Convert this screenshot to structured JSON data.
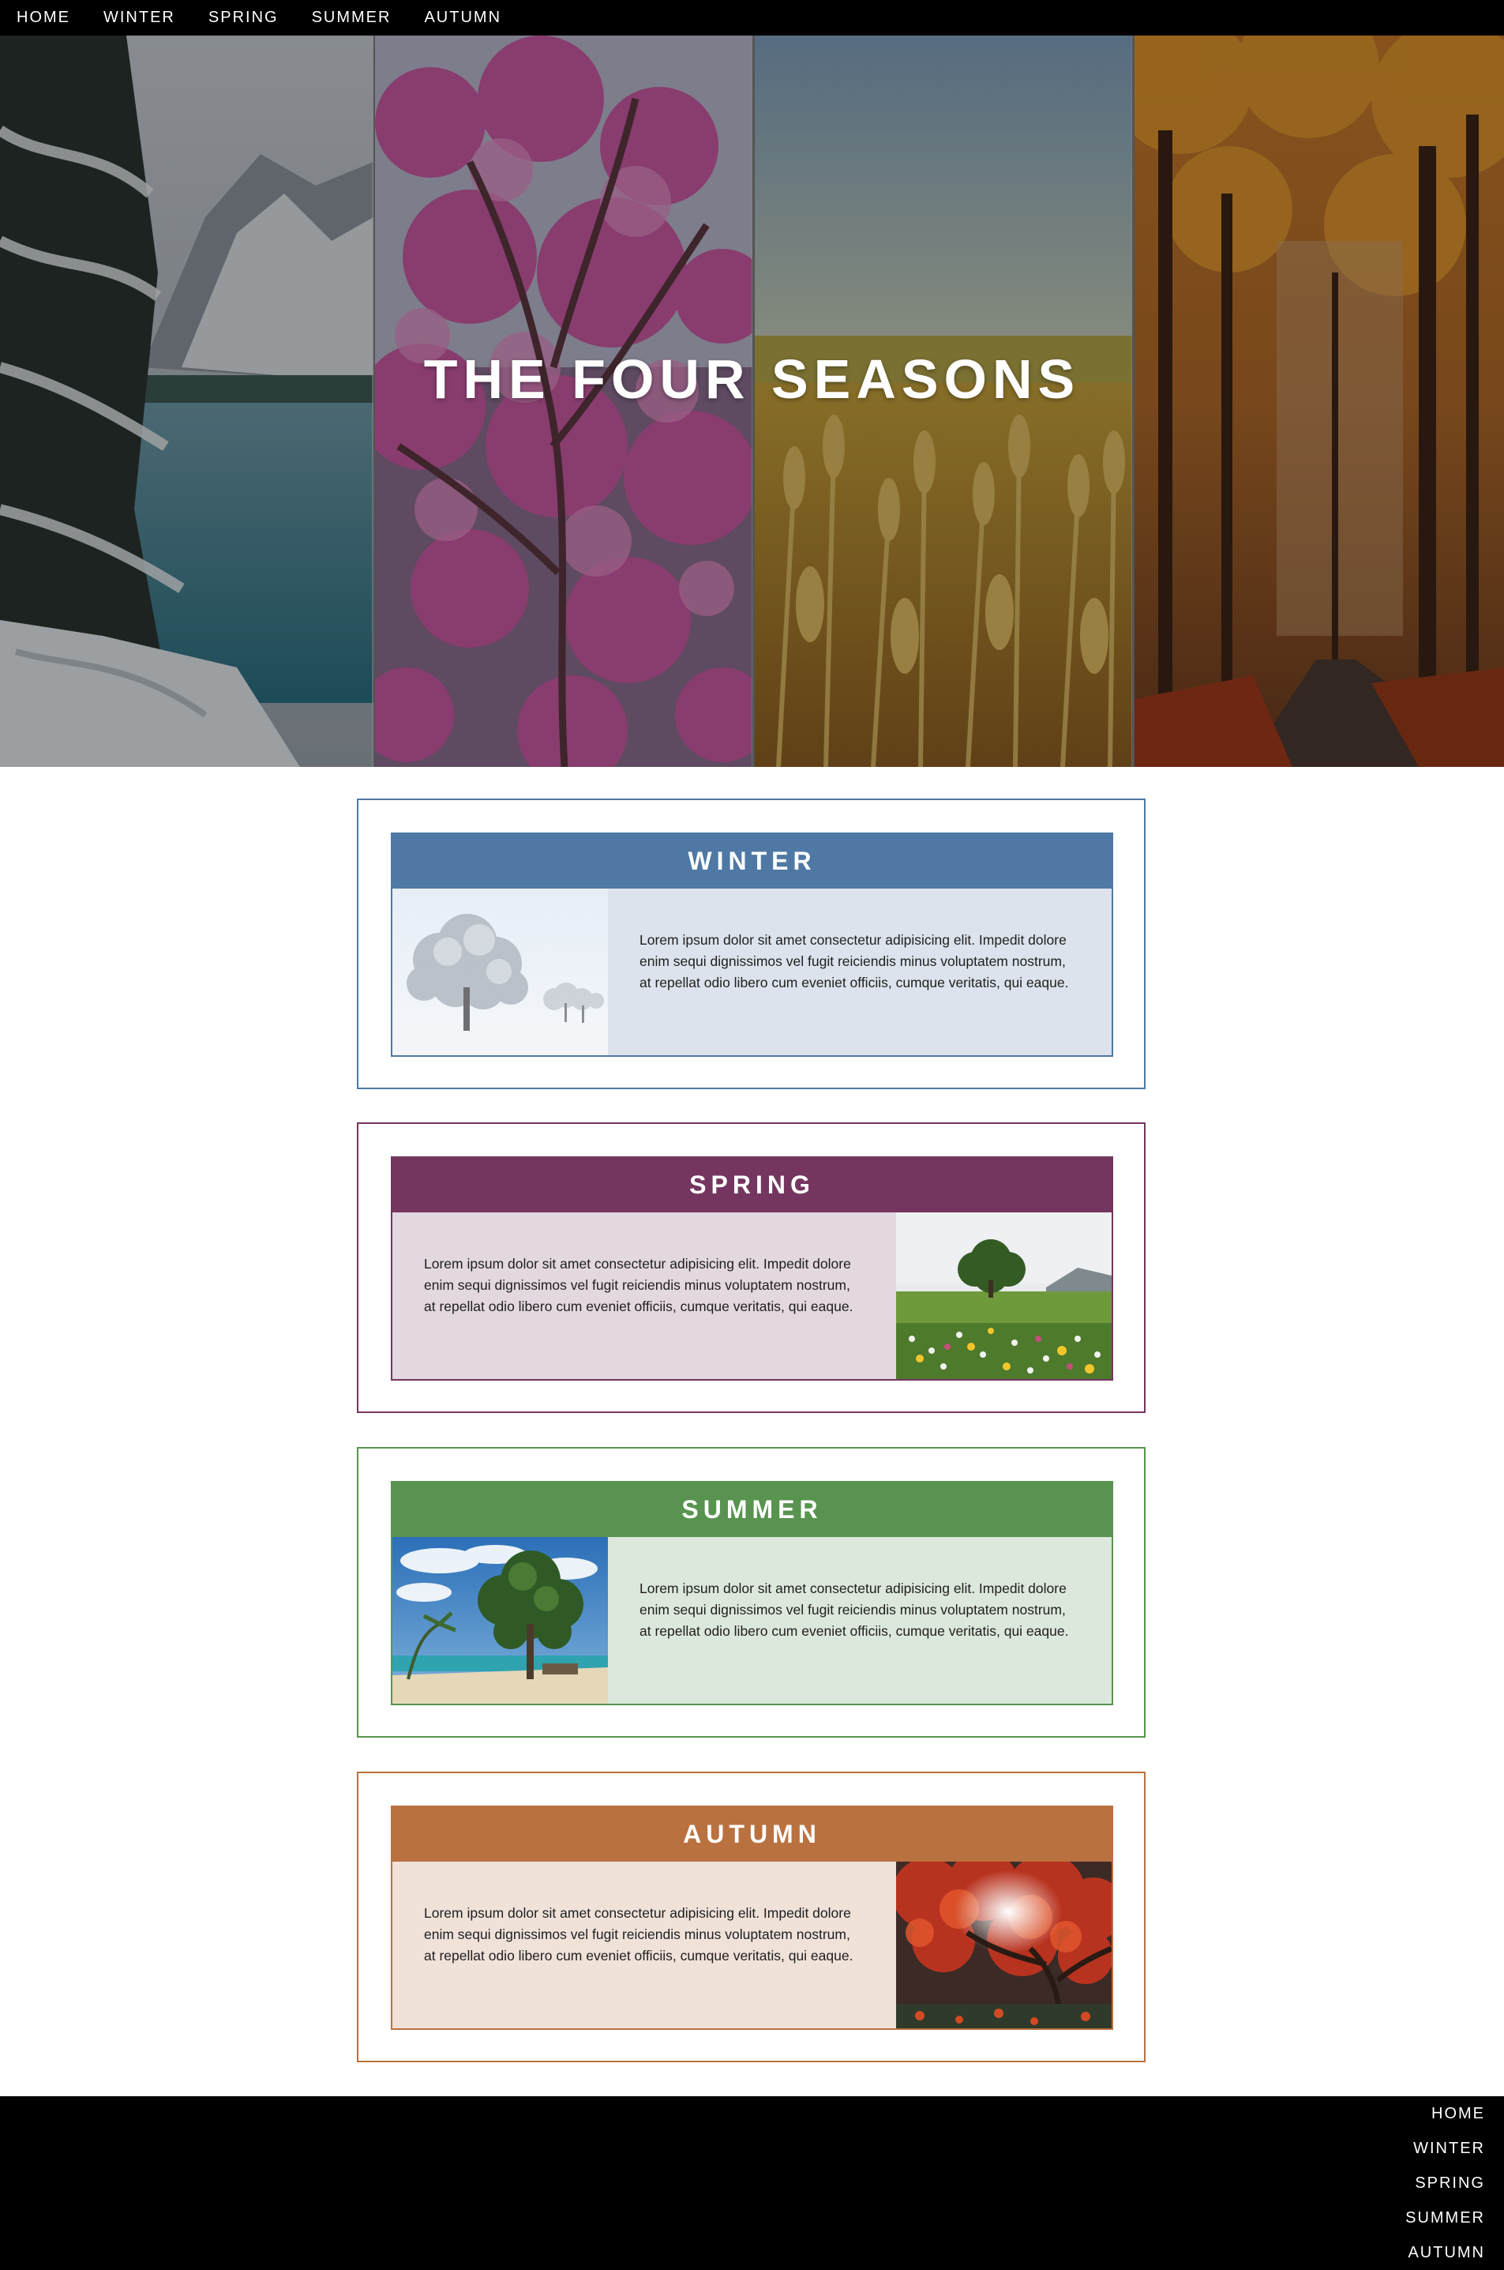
{
  "nav": {
    "items": [
      "HOME",
      "WINTER",
      "SPRING",
      "SUMMER",
      "AUTUMN"
    ]
  },
  "hero": {
    "title": "THE FOUR SEASONS",
    "panels": [
      "winter-lake-photo",
      "spring-blossom-photo",
      "summer-wheat-photo",
      "autumn-forest-photo"
    ]
  },
  "seasons": [
    {
      "title": "WINTER",
      "text": "Lorem ipsum dolor sit amet consectetur adipisicing elit. Impedit dolore enim sequi dignissimos vel fugit reiciendis minus voluptatem nostrum, at repellat odio libero cum eveniet officiis, cumque veritatis, qui eaque.",
      "image": "snowy-tree-photo",
      "accent": "#4f79a4",
      "tint": "#dde3ec"
    },
    {
      "title": "SPRING",
      "text": "Lorem ipsum dolor sit amet consectetur adipisicing elit. Impedit dolore enim sequi dignissimos vel fugit reiciendis minus voluptatem nostrum, at repellat odio libero cum eveniet officiis, cumque veritatis, qui eaque.",
      "image": "flower-meadow-photo",
      "accent": "#74365f",
      "tint": "#e3d7e0"
    },
    {
      "title": "SUMMER",
      "text": "Lorem ipsum dolor sit amet consectetur adipisicing elit. Impedit dolore enim sequi dignissimos vel fugit reiciendis minus voluptatem nostrum, at repellat odio libero cum eveniet officiis, cumque veritatis, qui eaque.",
      "image": "beach-tree-photo",
      "accent": "#58944f",
      "tint": "#dde8dc"
    },
    {
      "title": "AUTUMN",
      "text": "Lorem ipsum dolor sit amet consectetur adipisicing elit. Impedit dolore enim sequi dignissimos vel fugit reiciendis minus voluptatem nostrum, at repellat odio libero cum eveniet officiis, cumque veritatis, qui eaque.",
      "image": "red-maple-photo",
      "accent": "#ba7140",
      "tint": "#f0e2d9"
    }
  ],
  "footer": {
    "items": [
      "HOME",
      "WINTER",
      "SPRING",
      "SUMMER",
      "AUTUMN"
    ]
  }
}
